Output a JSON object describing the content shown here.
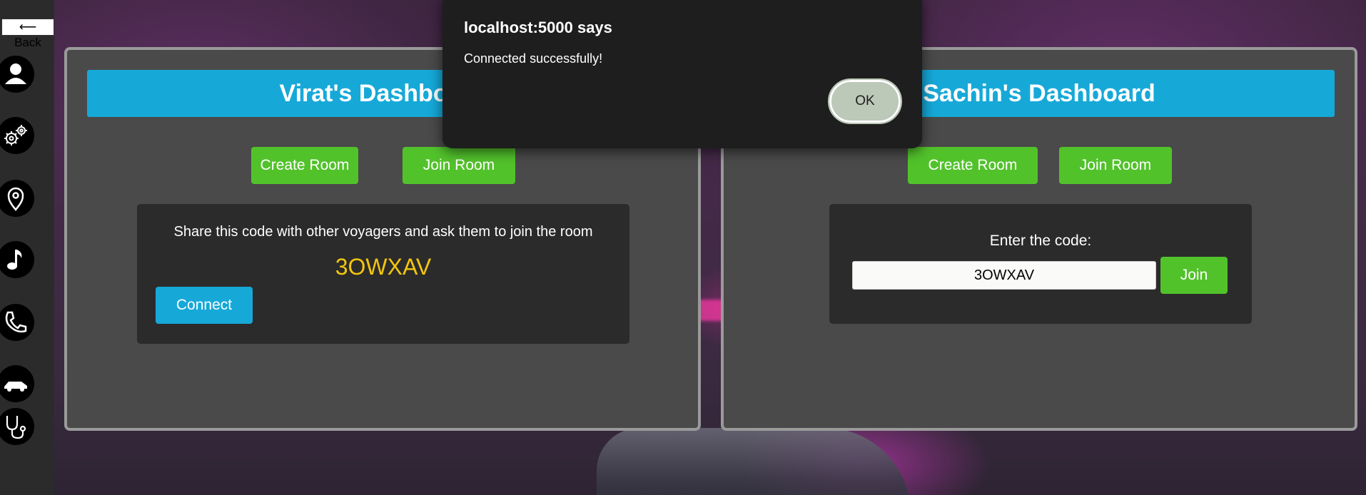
{
  "sidebar": {
    "back_label": "⟵ Back",
    "icons": [
      "user-icon",
      "gears-icon",
      "location-pin-icon",
      "music-note-icon",
      "phone-icon",
      "car-icon",
      "stethoscope-icon"
    ]
  },
  "left_panel": {
    "title": "Virat's Dashboard",
    "create_room_label": "Create Room",
    "join_room_label": "Join Room",
    "share_text": "Share this code with other voyagers and ask them to join the room",
    "room_code": "3OWXAV",
    "connect_label": "Connect"
  },
  "right_panel": {
    "title": "Sachin's Dashboard",
    "create_room_label": "Create Room",
    "join_room_label": "Join Room",
    "enter_code_label": "Enter the code:",
    "code_input_value": "3OWXAV",
    "join_label": "Join"
  },
  "dialog": {
    "title": "localhost:5000 says",
    "message": "Connected successfully!",
    "ok_label": "OK"
  },
  "colors": {
    "accent_blue": "#16a9d8",
    "accent_green": "#52c22b",
    "code_yellow": "#f3c60f",
    "panel_bg": "#4a4a4a",
    "dialog_bg": "#1e1e1e"
  }
}
